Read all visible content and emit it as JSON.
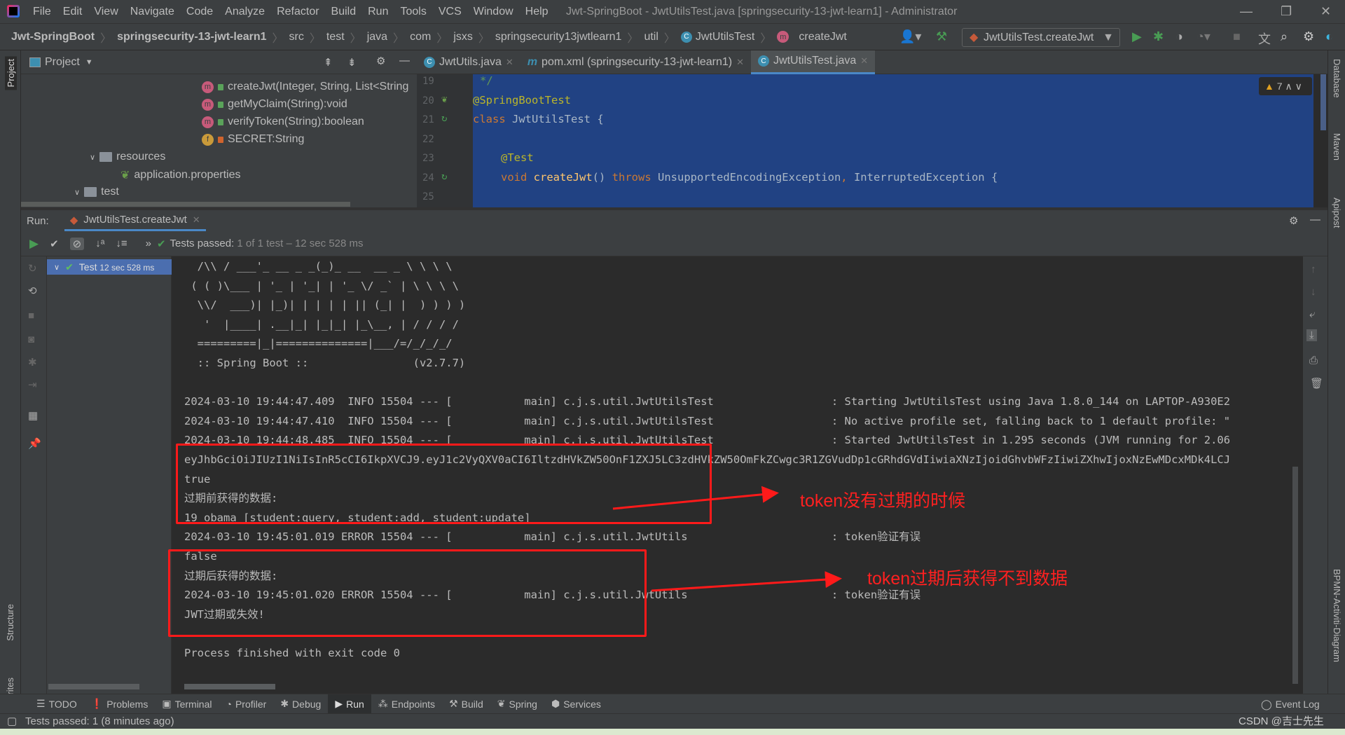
{
  "window": {
    "title": "Jwt-SpringBoot - JwtUtilsTest.java [springsecurity-13-jwt-learn1] - Administrator",
    "menu": [
      "File",
      "Edit",
      "View",
      "Navigate",
      "Code",
      "Analyze",
      "Refactor",
      "Build",
      "Run",
      "Tools",
      "VCS",
      "Window",
      "Help"
    ]
  },
  "breadcrumb": [
    "Jwt-SpringBoot",
    "springsecurity-13-jwt-learn1",
    "src",
    "test",
    "java",
    "com",
    "jsxs",
    "springsecurity13jwtlearn1",
    "util",
    "JwtUtilsTest",
    "createJwt"
  ],
  "toolbar": {
    "run_config": "JwtUtilsTest.createJwt"
  },
  "left_strip": {
    "project": "Project",
    "structure": "Structure",
    "favorites": "Favorites"
  },
  "right_strip": {
    "database": "Database",
    "maven": "Maven",
    "apipost": "Apipost",
    "bpmn": "BPMN-Activiti-Diagram"
  },
  "project": {
    "title": "Project",
    "tree": [
      {
        "label": "createJwt(Integer, String, List<String",
        "icon": "method-icon"
      },
      {
        "label": "getMyClaim(String):void",
        "icon": "method-icon"
      },
      {
        "label": "verifyToken(String):boolean",
        "icon": "method-icon"
      },
      {
        "label": "SECRET:String",
        "icon": "field-icon"
      },
      {
        "label": "resources",
        "icon": "folder-icon"
      },
      {
        "label": "application.properties",
        "icon": "spring-properties-icon"
      },
      {
        "label": "test",
        "icon": "folder-icon"
      }
    ]
  },
  "editor": {
    "tabs": [
      {
        "label": "JwtUtils.java",
        "active": false
      },
      {
        "label": "pom.xml (springsecurity-13-jwt-learn1)",
        "active": false
      },
      {
        "label": "JwtUtilsTest.java",
        "active": true
      }
    ],
    "line_numbers": [
      "19",
      "20",
      "21",
      "22",
      "23",
      "24",
      "25"
    ],
    "warnings_count": "7",
    "code": {
      "l19": "*/",
      "l20": "@SpringBootTest",
      "l21_kw": "class",
      "l21_rest": " JwtUtilsTest {",
      "l23": "@Test",
      "l24_void": "void",
      "l24_fn": "createJwt",
      "l24_paren": "() ",
      "l24_throws": "throws",
      "l24_rest1": " UnsupportedEncodingException",
      "l24_comma": ",",
      "l24_rest2": " InterruptedException {"
    }
  },
  "run": {
    "label": "Run:",
    "tab": "JwtUtilsTest.createJwt",
    "status_prefix": "Tests passed:",
    "status_detail": "1 of 1 test – 12 sec 528 ms",
    "test_node": "Test",
    "test_time": "12 sec 528 ms",
    "console": [
      "  /\\\\ / ___'_ __ _ _(_)_ __  __ _ \\ \\ \\ \\",
      " ( ( )\\___ | '_ | '_| | '_ \\/ _` | \\ \\ \\ \\",
      "  \\\\/  ___)| |_)| | | | | || (_| |  ) ) ) )",
      "   '  |____| .__|_| |_|_| |_\\__, | / / / /",
      "  =========|_|==============|___/=/_/_/_/",
      "  :: Spring Boot ::                (v2.7.7)",
      "",
      "2024-03-10 19:44:47.409  INFO 15504 --- [           main] c.j.s.util.JwtUtilsTest                  : Starting JwtUtilsTest using Java 1.8.0_144 on LAPTOP-A930E2",
      "2024-03-10 19:44:47.410  INFO 15504 --- [           main] c.j.s.util.JwtUtilsTest                  : No active profile set, falling back to 1 default profile: \"",
      "2024-03-10 19:44:48.485  INFO 15504 --- [           main] c.j.s.util.JwtUtilsTest                  : Started JwtUtilsTest in 1.295 seconds (JVM running for 2.06",
      "eyJhbGciOiJIUzI1NiIsInR5cCI6IkpXVCJ9.eyJ1c2VyQXV0aCI6IltzdHVkZW50OnF1ZXJ5LC3zdHVkZW50OmFkZCwgc3R1ZGVudDp1cGRhdGVdIiwiaXNzIjoidGhvbWFzIiwiZXhwIjoxNzEwMDcxMDk4LCJ",
      "true",
      "过期前获得的数据:",
      "19 obama [student:query, student:add, student:update]",
      "2024-03-10 19:45:01.019 ERROR 15504 --- [           main] c.j.s.util.JwtUtils                      : token验证有误",
      "false",
      "过期后获得的数据:",
      "2024-03-10 19:45:01.020 ERROR 15504 --- [           main] c.j.s.util.JwtUtils                      : token验证有误",
      "JWT过期或失效!",
      "",
      "Process finished with exit code 0"
    ]
  },
  "annotations": {
    "label1": "token没有过期的时候",
    "label2": "token过期后获得不到数据",
    "color": "#ff1a1a"
  },
  "tool_tabs": [
    "TODO",
    "Problems",
    "Terminal",
    "Profiler",
    "Debug",
    "Run",
    "Endpoints",
    "Build",
    "Spring",
    "Services"
  ],
  "active_tool_tab": "Run",
  "event_log": "Event Log",
  "status": "Tests passed: 1 (8 minutes ago)",
  "watermark": "CSDN @吉士先生",
  "colors": {
    "accent": "#4a88c7",
    "selection": "#4b6eaf",
    "editor_bg": "#214283",
    "run_green": "#499c54"
  }
}
